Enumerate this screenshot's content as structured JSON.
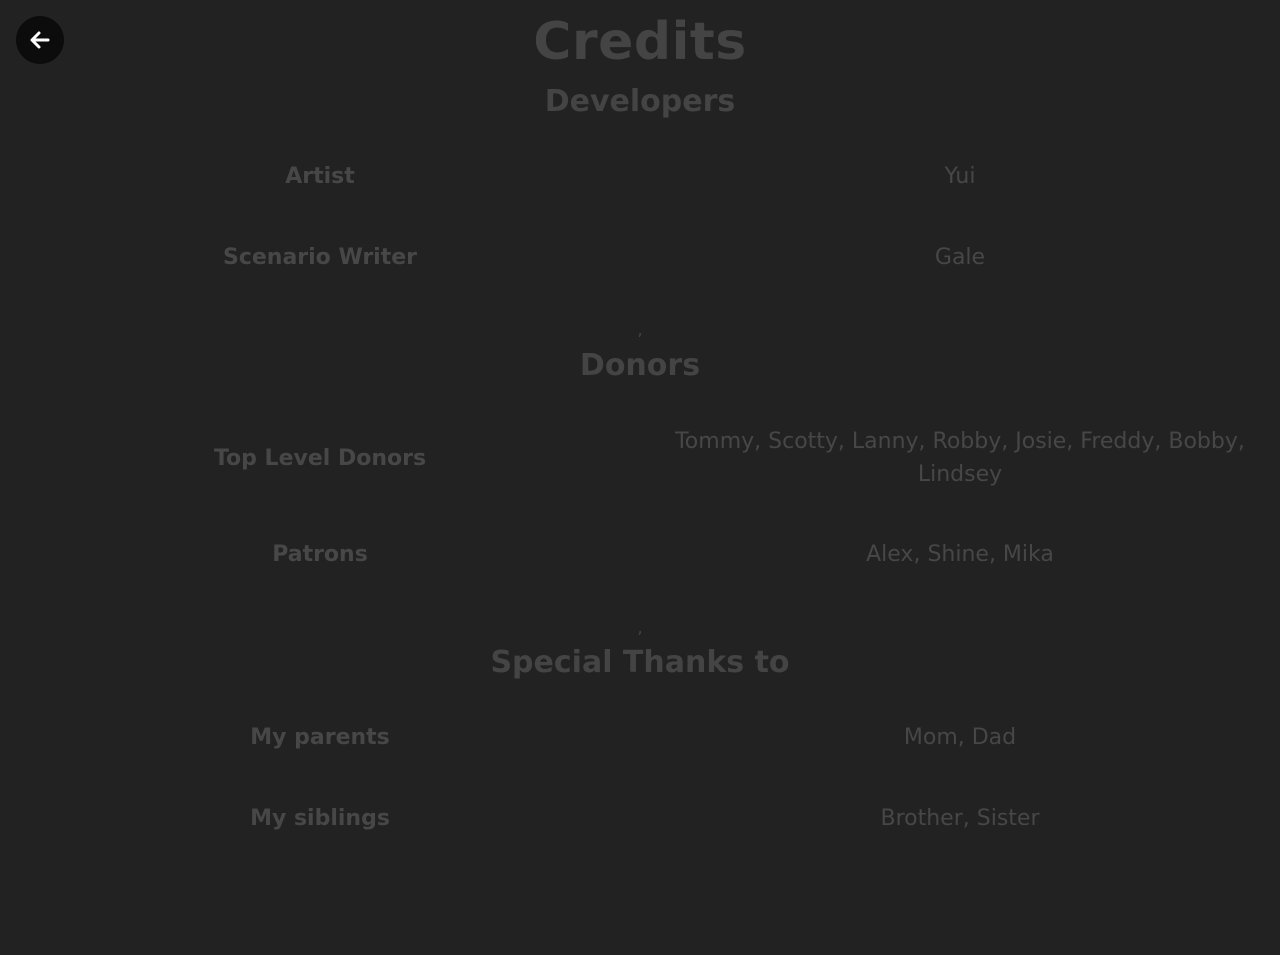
{
  "title": "Credits",
  "back_icon": "arrow-left-icon",
  "colors": {
    "background": "#222222",
    "text": "#444444",
    "back_button_bg": "#0c0c0c",
    "back_button_icon": "#ffffff"
  },
  "sections": [
    {
      "heading": "Developers",
      "rows": [
        {
          "role": "Artist",
          "names": "Yui"
        },
        {
          "role": "Scenario Writer",
          "names": "Gale"
        }
      ],
      "separator": ","
    },
    {
      "heading": "Donors",
      "rows": [
        {
          "role": "Top Level Donors",
          "names": "Tommy, Scotty, Lanny, Robby, Josie, Freddy, Bobby, Lindsey"
        },
        {
          "role": "Patrons",
          "names": "Alex, Shine, Mika"
        }
      ],
      "separator": ","
    },
    {
      "heading": "Special Thanks to",
      "rows": [
        {
          "role": "My parents",
          "names": "Mom, Dad"
        },
        {
          "role": "My siblings",
          "names": "Brother, Sister"
        }
      ]
    }
  ]
}
